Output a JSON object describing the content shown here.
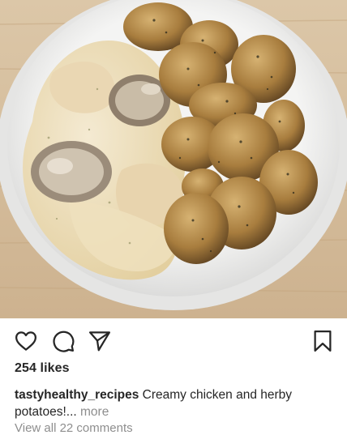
{
  "post": {
    "image_alt": "Bowl of creamy chicken with mushrooms and roasted herby potatoes",
    "likes_text": "254 likes",
    "username": "tastyhealthy_recipes",
    "caption_text": "Creamy chicken and herby potatoes!...",
    "more_label": "more",
    "view_comments_text": "View all 22 comments"
  },
  "icons": {
    "like": "heart-icon",
    "comment": "comment-icon",
    "share": "paper-plane-icon",
    "save": "bookmark-icon"
  },
  "colors": {
    "text": "#262626",
    "muted": "#8e8e8e",
    "background": "#ffffff"
  }
}
